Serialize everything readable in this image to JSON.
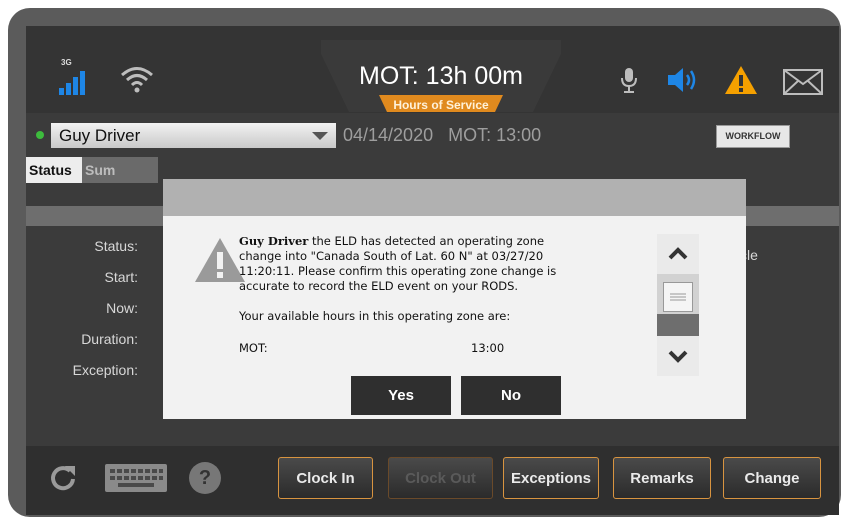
{
  "topbar": {
    "network_label": "3G",
    "hos_title": "MOT: 13h 00m",
    "hos_subtitle": "Hours of Service"
  },
  "driver_row": {
    "driver_name": "Guy Driver",
    "date_status": "04/14/2020   MOT: 13:00",
    "workflow_label": "WORKFLOW"
  },
  "tabs": [
    {
      "label": "Status",
      "active": true
    },
    {
      "label": "Sum",
      "active": false
    }
  ],
  "status_fields": [
    {
      "label": "Status:"
    },
    {
      "label": "Start:"
    },
    {
      "label": "Now:"
    },
    {
      "label": "Duration:"
    },
    {
      "label": "Exception:"
    }
  ],
  "right_partial_text": "cycle",
  "dialog": {
    "driver_name": "Guy Driver",
    "message_rest": " the ELD has detected an operating zone change into \"Canada South of Lat. 60 N\" at 03/27/20 11:20:11. Please confirm this operating zone change is accurate to record the ELD event on your RODS.",
    "available_text": "Your available hours in this operating zone are:",
    "hours_label": "MOT:",
    "hours_value": "13:00",
    "yes_label": "Yes",
    "no_label": "No"
  },
  "bottombar": {
    "help_glyph": "?",
    "buttons": [
      {
        "label": "Clock In",
        "enabled": true
      },
      {
        "label": "Clock Out",
        "enabled": false
      },
      {
        "label": "Exceptions",
        "enabled": true
      },
      {
        "label": "Remarks",
        "enabled": true
      },
      {
        "label": "Change",
        "enabled": true
      }
    ]
  },
  "colors": {
    "accent_orange": "#e08a1e",
    "warning_orange": "#f5a000",
    "speaker_blue": "#1e86e6",
    "status_green": "#3dbb3d"
  },
  "icons": [
    "signal-icon",
    "wifi-icon",
    "microphone-icon",
    "speaker-icon",
    "warning-icon",
    "mail-icon",
    "refresh-icon",
    "keyboard-icon",
    "help-icon",
    "dropdown-arrow-icon",
    "chevron-up-icon",
    "chevron-down-icon"
  ]
}
